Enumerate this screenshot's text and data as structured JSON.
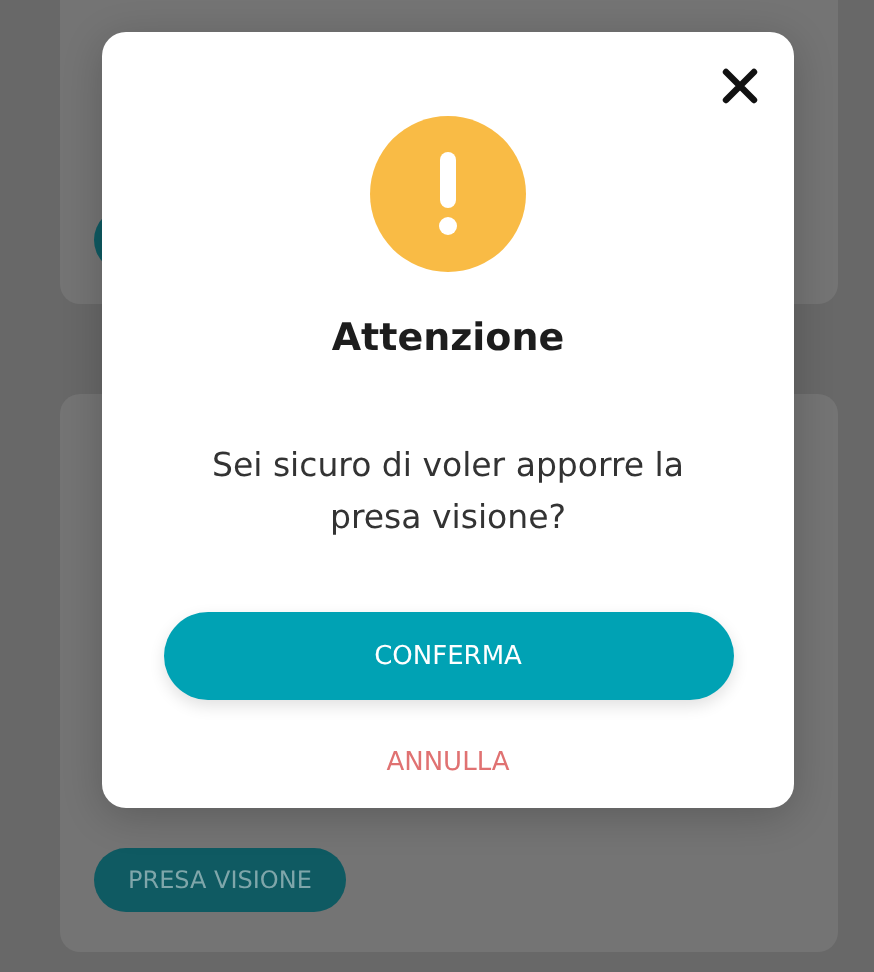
{
  "background": {
    "action_button": "PRESA VISIONE"
  },
  "dialog": {
    "title": "Attenzione",
    "message": "Sei sicuro di voler apporre la presa visione?",
    "confirm": "CONFERMA",
    "cancel": "ANNULLA"
  }
}
